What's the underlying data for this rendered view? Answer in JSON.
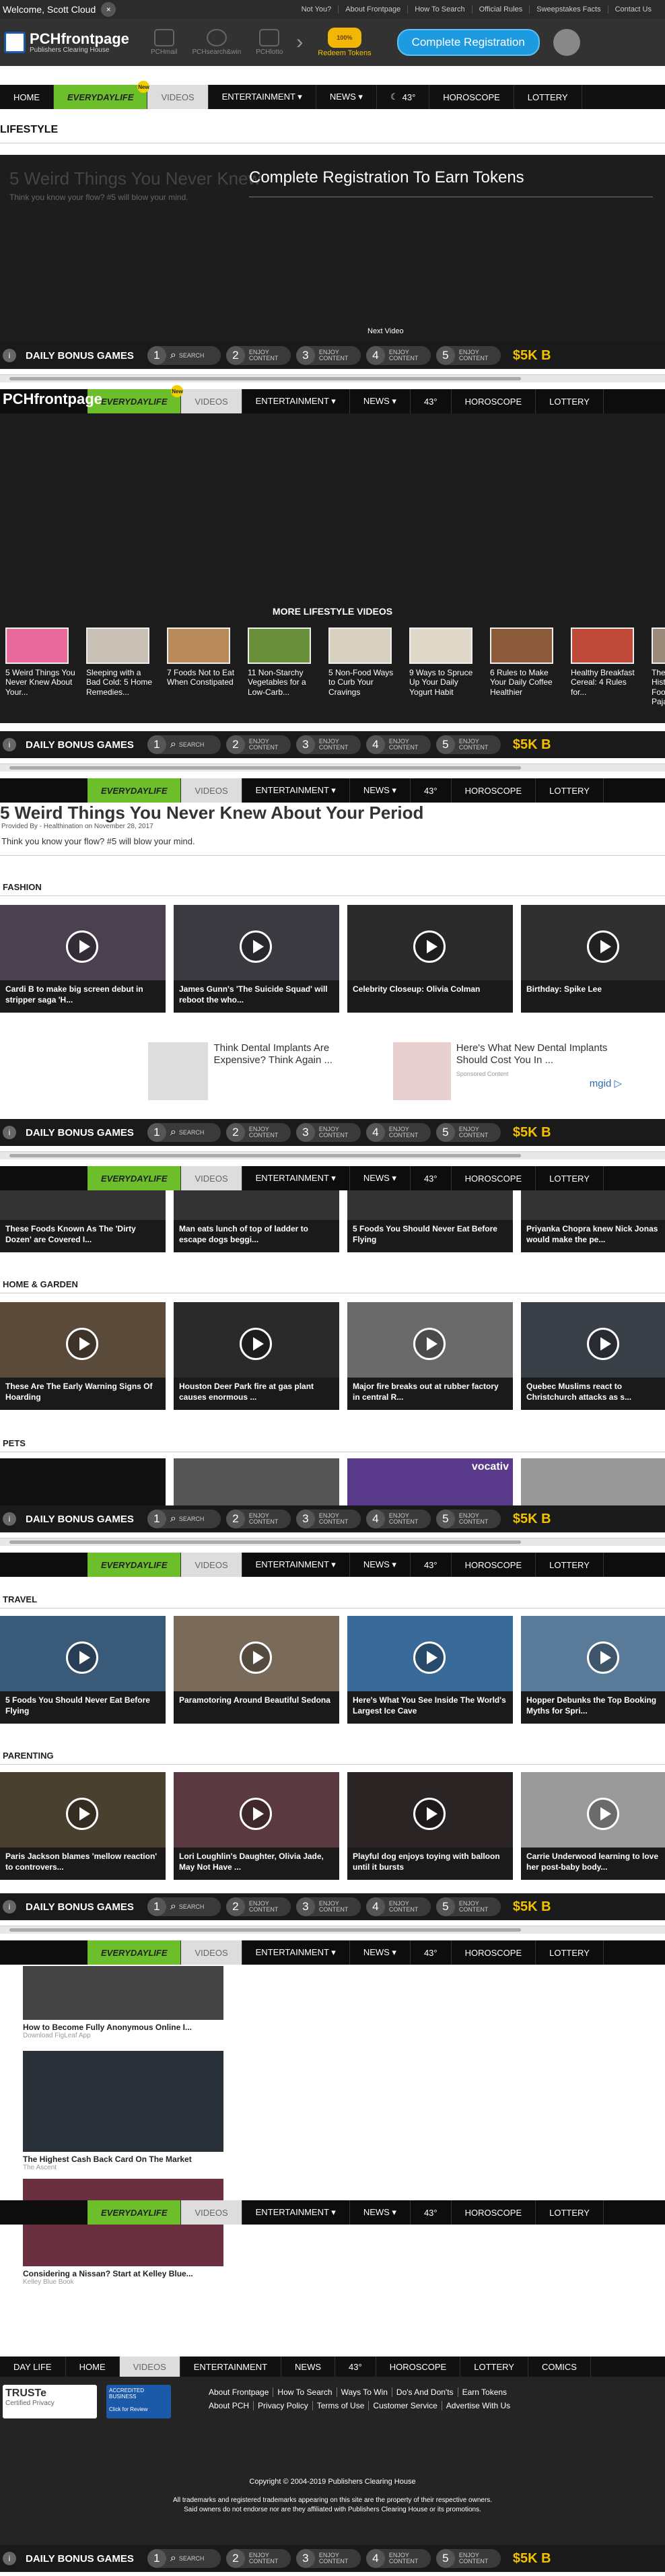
{
  "topbar": {
    "welcome": "Welcome, Scott Cloud",
    "close_label": "×",
    "links": [
      "Not You?",
      "About Frontpage",
      "How To Search",
      "Official Rules",
      "Sweepstakes Facts",
      "Contact Us"
    ]
  },
  "masthead": {
    "logo_title": "PCHfrontpage",
    "logo_sub": "Publishers Clearing House",
    "icons": [
      "PCHmail",
      "PCHsearch&win",
      "PCHlotto"
    ],
    "chevron": "›",
    "tokens_coin": "100%",
    "tokens_label": "Redeem Tokens",
    "register": "Complete Registration"
  },
  "nav": {
    "items": [
      "HOME",
      "EVERYDAYLIFE",
      "VIDEOS",
      "ENTERTAINMENT ▾",
      "NEWS ▾",
      "43°",
      "HOROSCOPE",
      "LOTTERY"
    ],
    "new_badge": "New"
  },
  "nav2": {
    "items": [
      "DAY LIFE",
      "HOME",
      "VIDEOS",
      "ENTERTAINMENT",
      "NEWS",
      "43°",
      "HOROSCOPE",
      "LOTTERY",
      "COMICS"
    ]
  },
  "bonus": {
    "info": "i",
    "title": "DAILY BONUS GAMES",
    "tasks": [
      {
        "num": "1",
        "label": "SEARCH"
      },
      {
        "num": "2",
        "label": "ENJOY CONTENT"
      },
      {
        "num": "3",
        "label": "ENJOY CONTENT"
      },
      {
        "num": "4",
        "label": "ENJOY CONTENT"
      },
      {
        "num": "5",
        "label": "ENJOY CONTENT"
      }
    ],
    "prize": "$5K B"
  },
  "lifestyle": {
    "heading": "LIFESTYLE",
    "video_title": "5 Weird Things You Never Knew",
    "video_sub": "Think you know your flow? #5 will blow your mind.",
    "overlay": "Complete Registration To Earn Tokens",
    "next_video": "Next Video",
    "more_heading": "MORE LIFESTYLE VIDEOS",
    "more": [
      "5 Weird Things You Never Knew About Your...",
      "Sleeping with a Bad Cold: 5 Home Remedies...",
      "7 Foods Not to Eat When Constipated",
      "11 Non-Starchy Vegetables for a Low-Carb...",
      "5 Non-Food Ways to Curb Your Cravings",
      "9 Ways to Spruce Up Your Daily Yogurt Habit",
      "6 Rules to Make Your Daily Coffee Healthier",
      "Healthy Breakfast Cereal: 4 Rules for...",
      "The C Histo Footy Pajam"
    ]
  },
  "article": {
    "title": "5 Weird Things You Never Knew About Your Period",
    "provided": "Provided By - Healthination on November 28, 2017",
    "body": "Think you know your flow? #5 will blow your mind."
  },
  "sections": {
    "fashion": {
      "heading": "FASHION",
      "cards": [
        "Cardi B to make big screen debut in stripper saga 'H...",
        "James Gunn's 'The Suicide Squad' will reboot the who...",
        "Celebrity Closeup: Olivia Colman",
        "Birthday: Spike Lee"
      ]
    },
    "ads": [
      {
        "text": "Think Dental Implants Are Expensive? Think Again ..."
      },
      {
        "text": "Here's What New Dental Implants Should Cost You In ...",
        "sponsor": "Sponsored Content",
        "brand": "mgid ▷"
      }
    ],
    "food": {
      "cards": [
        "These Foods Known As The 'Dirty Dozen' are Covered I...",
        "Man eats lunch of top of ladder to escape dogs beggi...",
        "5 Foods You Should Never Eat Before Flying",
        "Priyanka Chopra knew Nick Jonas would make the pe..."
      ]
    },
    "home_garden": {
      "heading": "HOME & GARDEN",
      "cards": [
        "These Are The Early Warning Signs Of Hoarding",
        "Houston Deer Park fire at gas plant causes enormous ...",
        "Major fire breaks out at rubber factory in central R...",
        "Quebec Muslims react to Christchurch attacks as s..."
      ]
    },
    "pets": {
      "heading": "PETS",
      "vocativ": "vocativ"
    },
    "travel": {
      "heading": "TRAVEL",
      "cards": [
        "5 Foods You Should Never Eat Before Flying",
        "Paramotoring Around Beautiful Sedona",
        "Here's What You See Inside The World's Largest Ice Cave",
        "Hopper Debunks the Top Booking Myths for Spri..."
      ]
    },
    "parenting": {
      "heading": "PARENTING",
      "cards": [
        "Paris Jackson blames 'mellow reaction' to controvers...",
        "Lori Loughlin's Daughter, Olivia Jade, May Not Have ...",
        "Playful dog enjoys toying with balloon until it bursts",
        "Carrie Underwood learning to love her post-baby body..."
      ]
    }
  },
  "sponsored": [
    {
      "title": "How to Become Fully Anonymous Online I...",
      "source": "Download FigLeaf App"
    },
    {
      "title": "The Highest Cash Back Card On The Market",
      "source": "The Ascent"
    },
    {
      "title": "Considering a Nissan? Start at Kelley Blue...",
      "source": "Kelley Blue Book"
    }
  ],
  "footer": {
    "trust": "TRUSTe",
    "trust_sub": "Certified Privacy",
    "bbb": "ACCREDITED BUSINESS",
    "bbb_sub": "Click for Review",
    "row1": [
      "About Frontpage",
      "How To Search",
      "Ways To Win",
      "Do's And Don'ts",
      "Earn Tokens"
    ],
    "row2": [
      "About PCH",
      "Privacy Policy",
      "Terms of Use",
      "Customer Service",
      "Advertise With Us"
    ],
    "copyright": "Copyright © 2004-2019 Publishers Clearing House",
    "trademark1": "All trademarks and registered trademarks appearing on this site are the property of their respective owners.",
    "trademark2": "Said owners do not endorse nor are they affiliated with Publishers Clearing House or its promotions."
  },
  "colors": {
    "accent": "#1e9be0",
    "green": "#6cbf2b",
    "gold": "#f2c200"
  }
}
